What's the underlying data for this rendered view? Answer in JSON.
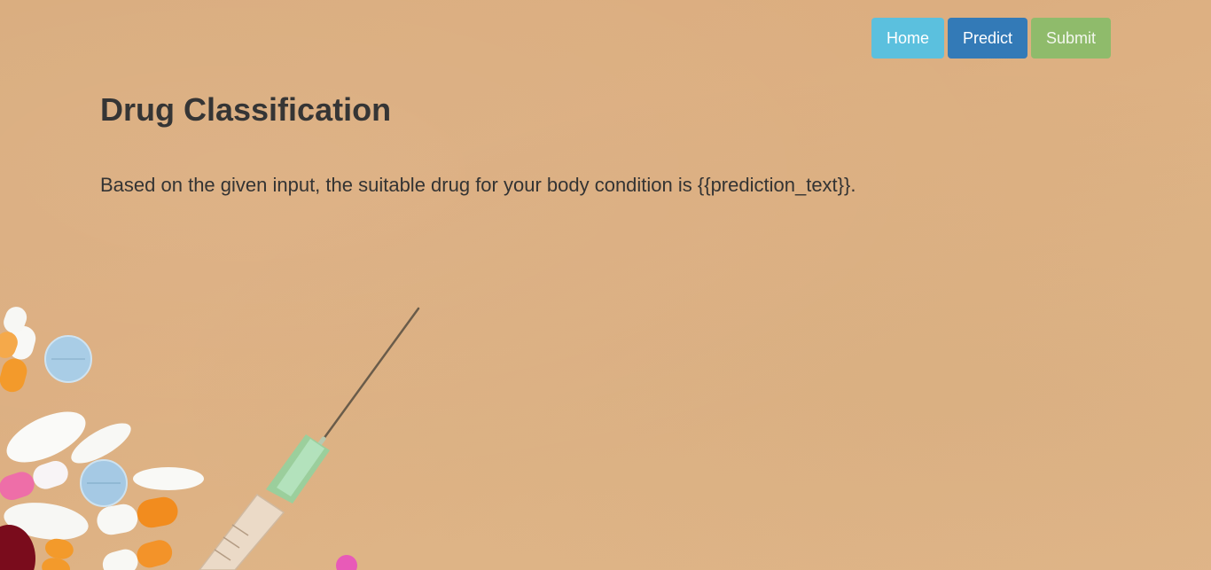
{
  "nav": {
    "home_label": "Home",
    "predict_label": "Predict",
    "submit_label": "Submit"
  },
  "main": {
    "title": "Drug Classification",
    "result_text": "Based on the given input, the suitable drug for your body condition is {{prediction_text}}."
  },
  "colors": {
    "background": "#dcae80",
    "home_button": "#5bc0de",
    "predict_button": "#337ab7",
    "submit_button": "#8fbb6b",
    "text": "#353535"
  },
  "icons": {
    "background_image": "pills-and-syringe"
  }
}
